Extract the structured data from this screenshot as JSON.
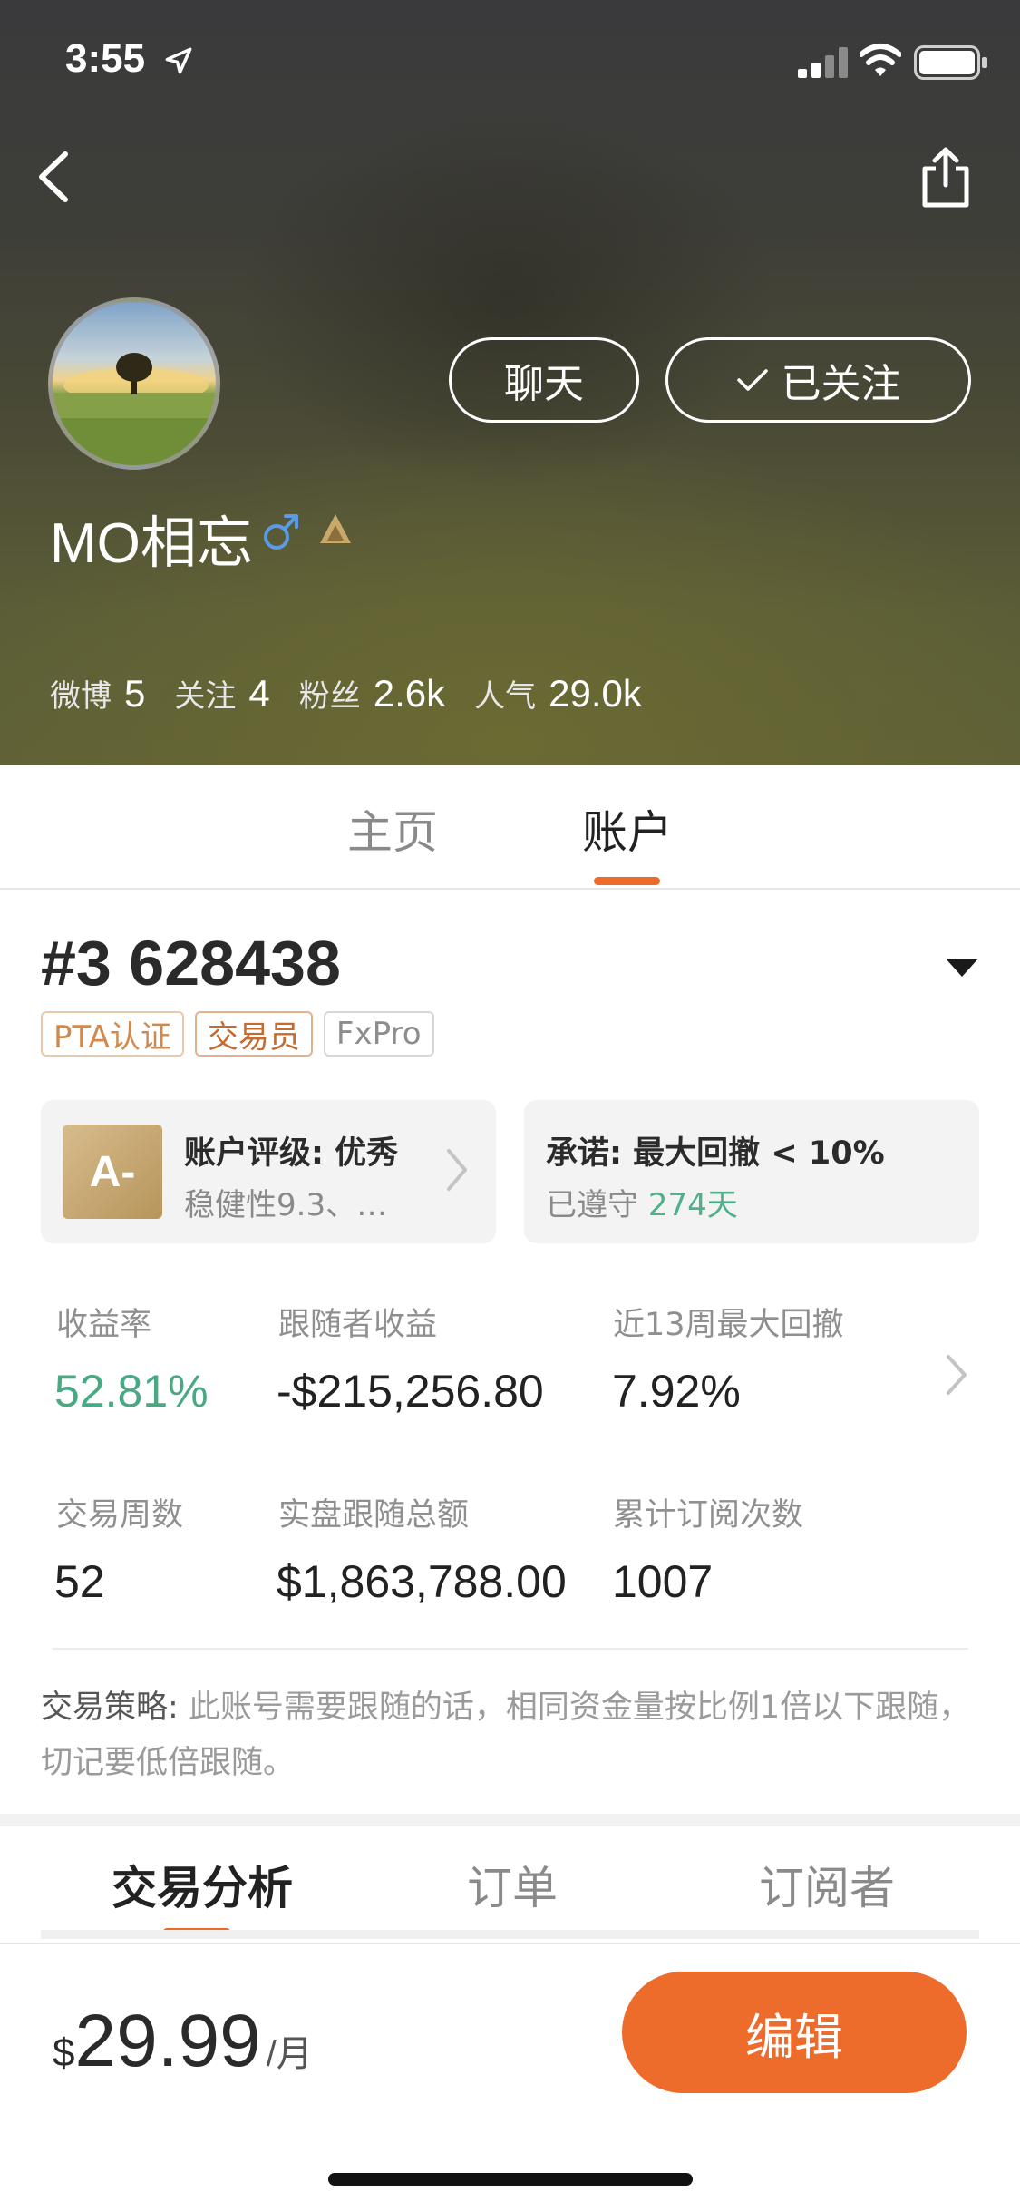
{
  "status_bar": {
    "time": "3:55"
  },
  "profile": {
    "username": "MO相忘",
    "follow_buttons": {
      "chat": "聊天",
      "followed": "已关注"
    },
    "stats": [
      {
        "label": "微博",
        "value": "5"
      },
      {
        "label": "关注",
        "value": "4"
      },
      {
        "label": "粉丝",
        "value": "2.6k"
      },
      {
        "label": "人气",
        "value": "29.0k"
      }
    ]
  },
  "profile_tabs": {
    "home": "主页",
    "account": "账户",
    "active": "account"
  },
  "account": {
    "id": "#3 628438",
    "tags": [
      "PTA认证",
      "交易员",
      "FxPro"
    ],
    "rating_card": {
      "badge": "A-",
      "title": "账户评级: 优秀",
      "subtitle": "稳健性9.3、…"
    },
    "promise_card": {
      "title": "承诺: 最大回撤 < 10%",
      "kept_prefix": "已遵守",
      "kept_days": "274天"
    },
    "metrics": {
      "return_label": "收益率",
      "return_value": "52.81%",
      "follower_profit_label": "跟随者收益",
      "follower_profit_value": "-$215,256.80",
      "drawdown_label": "近13周最大回撤",
      "drawdown_value": "7.92%",
      "weeks_label": "交易周数",
      "weeks_value": "52",
      "real_follow_label": "实盘跟随总额",
      "real_follow_value": "$1,863,788.00",
      "subscriptions_label": "累计订阅次数",
      "subscriptions_value": "1007"
    },
    "strategy": {
      "label": "交易策略:",
      "text": " 此账号需要跟随的话，相同资金量按比例1倍以下跟随，切记要低倍跟随。"
    }
  },
  "bottom_tabs": {
    "analysis": "交易分析",
    "orders": "订单",
    "subscribers": "订阅者",
    "active": "analysis"
  },
  "bottom_bar": {
    "currency": "$",
    "price": "29.99",
    "unit": "/月",
    "edit_label": "编辑"
  },
  "colors": {
    "accent": "#ee6c2b",
    "positive": "#4aa883",
    "gender": "#5a9be6",
    "rank": "#c9a86c"
  }
}
